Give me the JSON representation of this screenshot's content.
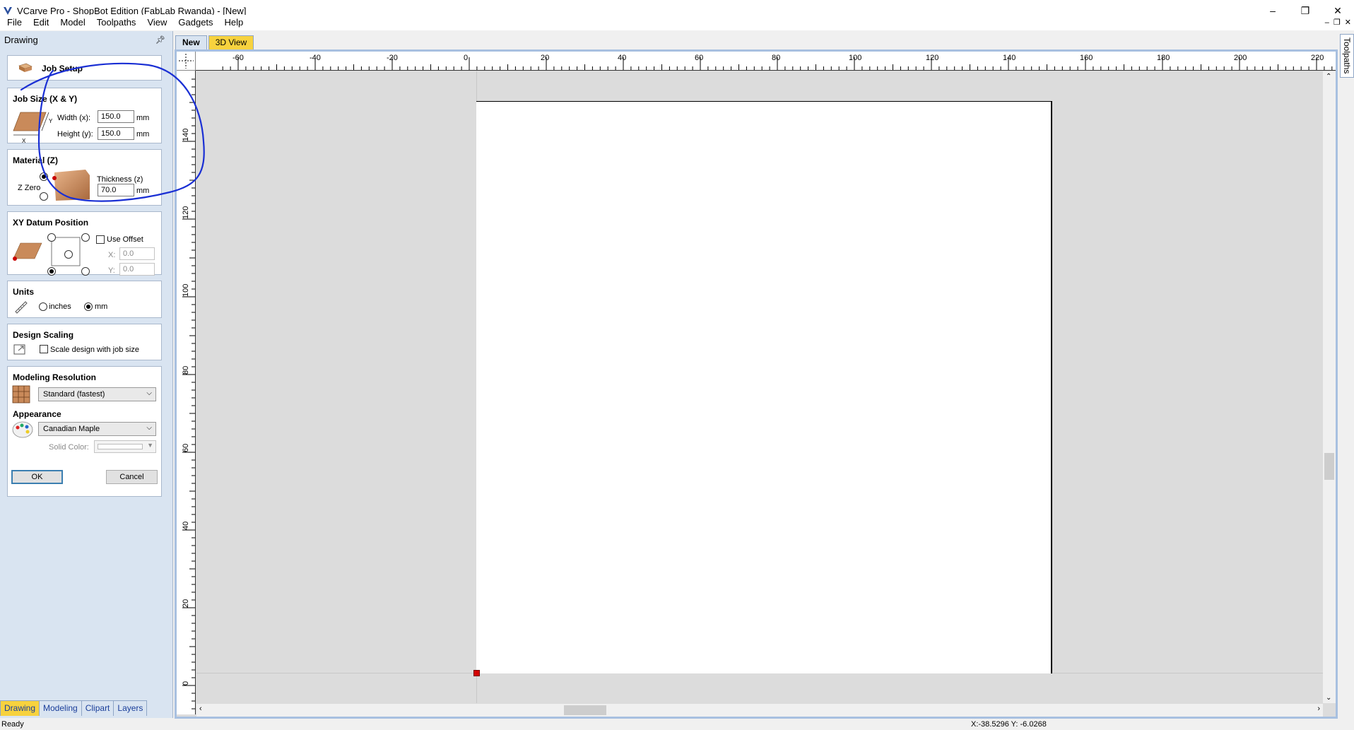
{
  "window": {
    "title": "VCarve Pro - ShopBot Edition (FabLab Rwanda) - [New]",
    "minimize": "–",
    "restore": "❐",
    "close": "✕"
  },
  "menu": {
    "items": [
      "File",
      "Edit",
      "Model",
      "Toolpaths",
      "View",
      "Gadgets",
      "Help"
    ],
    "mdi": [
      "–",
      "❐",
      "✕"
    ]
  },
  "panel": {
    "title": "Drawing",
    "pin": "ᚚ",
    "job_setup_label": "Job Setup",
    "job_size": {
      "title": "Job Size (X & Y)",
      "width_label": "Width (x):",
      "width_value": "150.0",
      "height_label": "Height (y):",
      "height_value": "150.0",
      "unit": "mm",
      "axis_x": "X",
      "axis_y": "Y"
    },
    "material": {
      "title": "Material (Z)",
      "zzero_label": "Z Zero",
      "thickness_label": "Thickness (z)",
      "thickness_value": "70.0",
      "unit": "mm"
    },
    "datum": {
      "title": "XY Datum Position",
      "use_offset_label": "Use Offset",
      "x_label": "X:",
      "x_value": "0.0",
      "y_label": "Y:",
      "y_value": "0.0"
    },
    "units": {
      "title": "Units",
      "inches_label": "inches",
      "mm_label": "mm"
    },
    "scaling": {
      "title": "Design Scaling",
      "checkbox_label": "Scale design with job size"
    },
    "resolution": {
      "title": "Modeling Resolution",
      "selected": "Standard (fastest)"
    },
    "appearance": {
      "title": "Appearance",
      "selected": "Canadian Maple",
      "solid_color_label": "Solid Color:"
    },
    "ok_label": "OK",
    "cancel_label": "Cancel"
  },
  "bottom_tabs": [
    "Drawing",
    "Modeling",
    "Clipart",
    "Layers"
  ],
  "doc_tabs": {
    "new": "New",
    "view3d": "3D View"
  },
  "side_tab": "Toolpaths",
  "rulers": {
    "h_labels": [
      "-60",
      "-40",
      "-20",
      "0",
      "20",
      "40",
      "60",
      "80",
      "100",
      "120",
      "140",
      "160",
      "180",
      "200",
      "220"
    ],
    "v_labels": [
      "140",
      "120",
      "100",
      "80",
      "60",
      "40",
      "20",
      "0"
    ]
  },
  "status": {
    "text": "Ready",
    "coords": "X:-38.5296 Y: -6.0268"
  },
  "colors": {
    "panel_bg": "#d9e4f1",
    "tab_active": "#f7d23e",
    "annotation": "#1a2fd4",
    "origin_marker": "#d40000",
    "material": "#c98a5a"
  }
}
